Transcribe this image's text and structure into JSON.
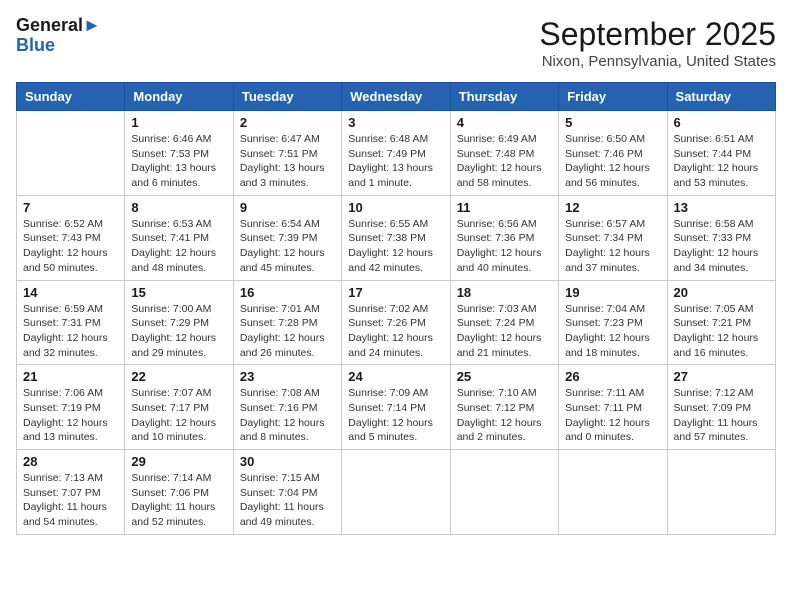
{
  "header": {
    "logo_line1": "General",
    "logo_line2": "Blue",
    "month": "September 2025",
    "location": "Nixon, Pennsylvania, United States"
  },
  "days_of_week": [
    "Sunday",
    "Monday",
    "Tuesday",
    "Wednesday",
    "Thursday",
    "Friday",
    "Saturday"
  ],
  "weeks": [
    [
      {
        "day": "",
        "sunrise": "",
        "sunset": "",
        "daylight": ""
      },
      {
        "day": "1",
        "sunrise": "Sunrise: 6:46 AM",
        "sunset": "Sunset: 7:53 PM",
        "daylight": "Daylight: 13 hours and 6 minutes."
      },
      {
        "day": "2",
        "sunrise": "Sunrise: 6:47 AM",
        "sunset": "Sunset: 7:51 PM",
        "daylight": "Daylight: 13 hours and 3 minutes."
      },
      {
        "day": "3",
        "sunrise": "Sunrise: 6:48 AM",
        "sunset": "Sunset: 7:49 PM",
        "daylight": "Daylight: 13 hours and 1 minute."
      },
      {
        "day": "4",
        "sunrise": "Sunrise: 6:49 AM",
        "sunset": "Sunset: 7:48 PM",
        "daylight": "Daylight: 12 hours and 58 minutes."
      },
      {
        "day": "5",
        "sunrise": "Sunrise: 6:50 AM",
        "sunset": "Sunset: 7:46 PM",
        "daylight": "Daylight: 12 hours and 56 minutes."
      },
      {
        "day": "6",
        "sunrise": "Sunrise: 6:51 AM",
        "sunset": "Sunset: 7:44 PM",
        "daylight": "Daylight: 12 hours and 53 minutes."
      }
    ],
    [
      {
        "day": "7",
        "sunrise": "Sunrise: 6:52 AM",
        "sunset": "Sunset: 7:43 PM",
        "daylight": "Daylight: 12 hours and 50 minutes."
      },
      {
        "day": "8",
        "sunrise": "Sunrise: 6:53 AM",
        "sunset": "Sunset: 7:41 PM",
        "daylight": "Daylight: 12 hours and 48 minutes."
      },
      {
        "day": "9",
        "sunrise": "Sunrise: 6:54 AM",
        "sunset": "Sunset: 7:39 PM",
        "daylight": "Daylight: 12 hours and 45 minutes."
      },
      {
        "day": "10",
        "sunrise": "Sunrise: 6:55 AM",
        "sunset": "Sunset: 7:38 PM",
        "daylight": "Daylight: 12 hours and 42 minutes."
      },
      {
        "day": "11",
        "sunrise": "Sunrise: 6:56 AM",
        "sunset": "Sunset: 7:36 PM",
        "daylight": "Daylight: 12 hours and 40 minutes."
      },
      {
        "day": "12",
        "sunrise": "Sunrise: 6:57 AM",
        "sunset": "Sunset: 7:34 PM",
        "daylight": "Daylight: 12 hours and 37 minutes."
      },
      {
        "day": "13",
        "sunrise": "Sunrise: 6:58 AM",
        "sunset": "Sunset: 7:33 PM",
        "daylight": "Daylight: 12 hours and 34 minutes."
      }
    ],
    [
      {
        "day": "14",
        "sunrise": "Sunrise: 6:59 AM",
        "sunset": "Sunset: 7:31 PM",
        "daylight": "Daylight: 12 hours and 32 minutes."
      },
      {
        "day": "15",
        "sunrise": "Sunrise: 7:00 AM",
        "sunset": "Sunset: 7:29 PM",
        "daylight": "Daylight: 12 hours and 29 minutes."
      },
      {
        "day": "16",
        "sunrise": "Sunrise: 7:01 AM",
        "sunset": "Sunset: 7:28 PM",
        "daylight": "Daylight: 12 hours and 26 minutes."
      },
      {
        "day": "17",
        "sunrise": "Sunrise: 7:02 AM",
        "sunset": "Sunset: 7:26 PM",
        "daylight": "Daylight: 12 hours and 24 minutes."
      },
      {
        "day": "18",
        "sunrise": "Sunrise: 7:03 AM",
        "sunset": "Sunset: 7:24 PM",
        "daylight": "Daylight: 12 hours and 21 minutes."
      },
      {
        "day": "19",
        "sunrise": "Sunrise: 7:04 AM",
        "sunset": "Sunset: 7:23 PM",
        "daylight": "Daylight: 12 hours and 18 minutes."
      },
      {
        "day": "20",
        "sunrise": "Sunrise: 7:05 AM",
        "sunset": "Sunset: 7:21 PM",
        "daylight": "Daylight: 12 hours and 16 minutes."
      }
    ],
    [
      {
        "day": "21",
        "sunrise": "Sunrise: 7:06 AM",
        "sunset": "Sunset: 7:19 PM",
        "daylight": "Daylight: 12 hours and 13 minutes."
      },
      {
        "day": "22",
        "sunrise": "Sunrise: 7:07 AM",
        "sunset": "Sunset: 7:17 PM",
        "daylight": "Daylight: 12 hours and 10 minutes."
      },
      {
        "day": "23",
        "sunrise": "Sunrise: 7:08 AM",
        "sunset": "Sunset: 7:16 PM",
        "daylight": "Daylight: 12 hours and 8 minutes."
      },
      {
        "day": "24",
        "sunrise": "Sunrise: 7:09 AM",
        "sunset": "Sunset: 7:14 PM",
        "daylight": "Daylight: 12 hours and 5 minutes."
      },
      {
        "day": "25",
        "sunrise": "Sunrise: 7:10 AM",
        "sunset": "Sunset: 7:12 PM",
        "daylight": "Daylight: 12 hours and 2 minutes."
      },
      {
        "day": "26",
        "sunrise": "Sunrise: 7:11 AM",
        "sunset": "Sunset: 7:11 PM",
        "daylight": "Daylight: 12 hours and 0 minutes."
      },
      {
        "day": "27",
        "sunrise": "Sunrise: 7:12 AM",
        "sunset": "Sunset: 7:09 PM",
        "daylight": "Daylight: 11 hours and 57 minutes."
      }
    ],
    [
      {
        "day": "28",
        "sunrise": "Sunrise: 7:13 AM",
        "sunset": "Sunset: 7:07 PM",
        "daylight": "Daylight: 11 hours and 54 minutes."
      },
      {
        "day": "29",
        "sunrise": "Sunrise: 7:14 AM",
        "sunset": "Sunset: 7:06 PM",
        "daylight": "Daylight: 11 hours and 52 minutes."
      },
      {
        "day": "30",
        "sunrise": "Sunrise: 7:15 AM",
        "sunset": "Sunset: 7:04 PM",
        "daylight": "Daylight: 11 hours and 49 minutes."
      },
      {
        "day": "",
        "sunrise": "",
        "sunset": "",
        "daylight": ""
      },
      {
        "day": "",
        "sunrise": "",
        "sunset": "",
        "daylight": ""
      },
      {
        "day": "",
        "sunrise": "",
        "sunset": "",
        "daylight": ""
      },
      {
        "day": "",
        "sunrise": "",
        "sunset": "",
        "daylight": ""
      }
    ]
  ]
}
